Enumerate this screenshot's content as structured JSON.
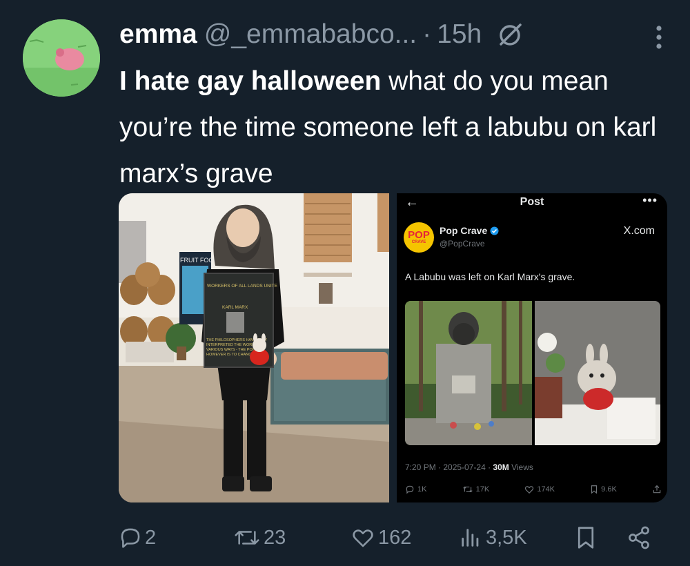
{
  "author": {
    "name": "emma",
    "handle": "@_emmababco...",
    "separator": "·",
    "time": "15h",
    "avatar_icon": "avatar-pig-on-grass"
  },
  "tweet": {
    "bold_text": "I hate gay halloween",
    "text": " what do you mean you’re the time someone left a labubu on karl marx’s grave"
  },
  "media": {
    "photo_left": {
      "sign_top": "WORKERS OF ALL LANDS UNITE",
      "sign_name": "KARL MARX",
      "sign_bottom": "THE PHILOSOPHERS HAVE ONLY INTERPRETED THE WORLD IN VARIOUS WAYS - THE POINT HOWEVER IS TO CHANGE IT",
      "store_sign": "FRUIT FOOD"
    },
    "embedded_post": {
      "back": "←",
      "title": "Post",
      "dots": "•••",
      "avatar_top": "POP",
      "avatar_bottom": "CRAVE",
      "name": "Pop Crave",
      "handle": "@PopCrave",
      "site": "X.com",
      "text": "A Labubu was left on Karl Marx's grave.",
      "meta_prefix": "7:20 PM · 2025-07-24 · ",
      "views_count": "30M",
      "views_label": " Views",
      "replies": "1K",
      "reposts": "17K",
      "likes": "174K",
      "bookmarks": "9.6K"
    }
  },
  "actions": {
    "replies": "2",
    "reposts": "23",
    "likes": "162",
    "views": "3,5K"
  },
  "colors": {
    "background": "#15202b",
    "text": "#ffffff",
    "muted": "#8b98a5",
    "verified": "#1d9bf0"
  }
}
